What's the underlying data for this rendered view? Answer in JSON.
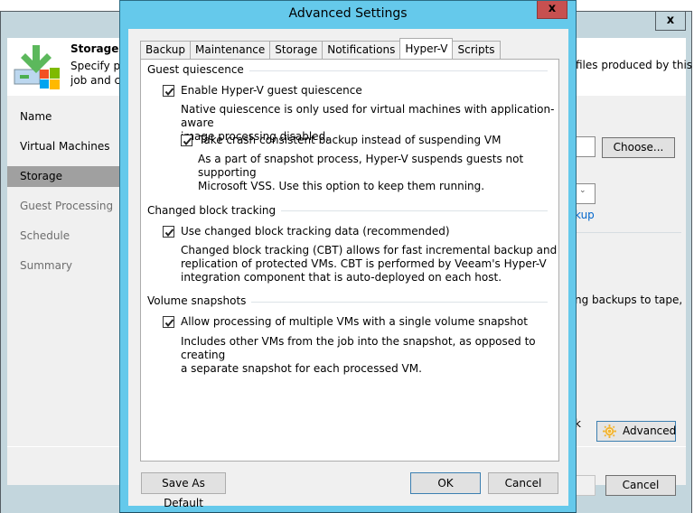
{
  "background_window": {
    "close_icon": "close-icon",
    "header": {
      "icon": "storage-windows-icon",
      "title": "Storage",
      "description_left": "Specify pr\njob and cu",
      "description_right": "files produced by this"
    },
    "nav_items": [
      {
        "label": "Name",
        "state": "done"
      },
      {
        "label": "Virtual Machines",
        "state": "done"
      },
      {
        "label": "Storage",
        "state": "active"
      },
      {
        "label": "Guest Processing",
        "state": "pending"
      },
      {
        "label": "Schedule",
        "state": "pending"
      },
      {
        "label": "Summary",
        "state": "pending"
      }
    ],
    "choose_button": "Choose...",
    "link_fragment": "kup",
    "tape_text_fragment": "ng backups to tape,",
    "k_fragment": "k",
    "advanced_button": "Advanced",
    "cancel_button": "Cancel"
  },
  "dialog": {
    "title": "Advanced Settings",
    "close_icon": "close-icon",
    "tabs": [
      {
        "label": "Backup",
        "active": false
      },
      {
        "label": "Maintenance",
        "active": false
      },
      {
        "label": "Storage",
        "active": false
      },
      {
        "label": "Notifications",
        "active": false
      },
      {
        "label": "Hyper-V",
        "active": true
      },
      {
        "label": "Scripts",
        "active": false
      }
    ],
    "groups": {
      "guest_quiescence": {
        "title": "Guest quiescence",
        "enable_label": "Enable Hyper-V guest quiescence",
        "enable_checked": true,
        "enable_desc_1": "Native quiescence is only used for virtual machines with application-aware",
        "enable_desc_2": "image processing disabled.",
        "crash_label": "Take crash consistent backup instead of suspending VM",
        "crash_checked": true,
        "crash_desc_1": "As a part of snapshot process, Hyper-V suspends guests not supporting",
        "crash_desc_2": "Microsoft VSS. Use this option to keep them running."
      },
      "cbt": {
        "title": "Changed block tracking",
        "label": "Use changed block tracking data (recommended)",
        "checked": true,
        "desc_1": "Changed block tracking (CBT) allows for fast incremental backup and",
        "desc_2": "replication of protected VMs. CBT is performed by Veeam's Hyper-V",
        "desc_3": "integration component that is auto-deployed on each host."
      },
      "volume_snapshots": {
        "title": "Volume snapshots",
        "label": "Allow processing of multiple VMs with a single volume snapshot",
        "checked": true,
        "desc_1": "Includes other VMs from the job into the snapshot, as opposed to creating",
        "desc_2": "a separate snapshot for each processed VM."
      }
    },
    "buttons": {
      "save_default": "Save As Default",
      "ok": "OK",
      "cancel": "Cancel"
    }
  }
}
